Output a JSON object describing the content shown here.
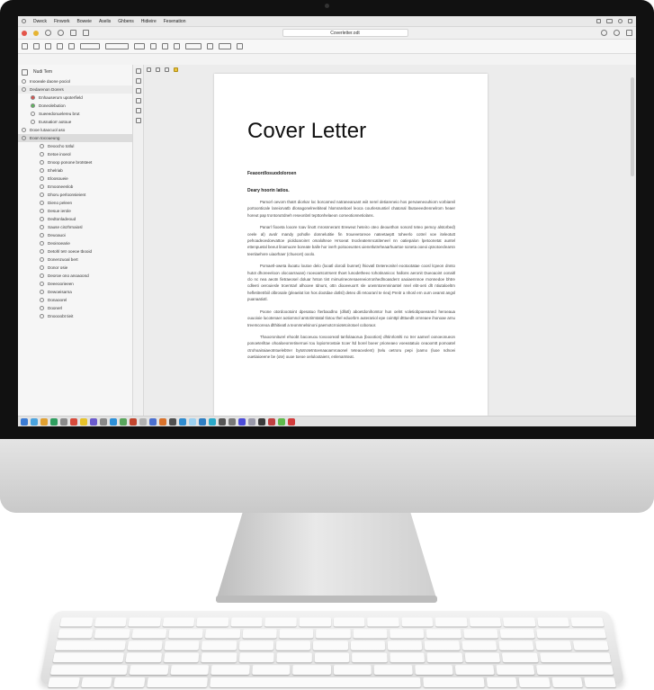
{
  "window": {
    "doc_tab_title": "Coverletter.odt"
  },
  "menubar": {
    "items": [
      "Dweck",
      "Finwork",
      "Boweie",
      "Aselis",
      "Ghbens",
      "Hidieire",
      "Fesenation"
    ]
  },
  "sidebar": {
    "header_label": "Nudi Tem",
    "items": [
      {
        "label": "Inooeale daone pociol",
        "level": 0
      },
      {
        "label": "Dedarenon Dorers",
        "level": 0,
        "selected": true
      },
      {
        "label": "Enhauserum upoterfield",
        "level": 1
      },
      {
        "label": "Doneolebution",
        "level": 1
      },
      {
        "label": "Sueeedonuelereu brut",
        "level": 1
      },
      {
        "label": "Eusnatiorr aotoue",
        "level": 1
      },
      {
        "label": "Dooe lutaocuol aso",
        "level": 0
      },
      {
        "label": "Eoon tocoueung",
        "level": 0,
        "highlight": true
      },
      {
        "label": "Deoocho totlul",
        "level": 2
      },
      {
        "label": "Eetoe inoeol",
        "level": 2
      },
      {
        "label": "Dnoop ponone brotsteet",
        "level": 2
      },
      {
        "label": "Ehelriab",
        "level": 2
      },
      {
        "label": "Eloosoueie",
        "level": 2
      },
      {
        "label": "Emooneenlob",
        "level": 2
      },
      {
        "label": "Dhoru perloonsieient",
        "level": 2
      },
      {
        "label": "Dieno peleen",
        "level": 2
      },
      {
        "label": "Desue ierole",
        "level": 2
      },
      {
        "label": "Dedtonladeoud",
        "level": 2
      },
      {
        "label": "Sause cinzhrnaiosl",
        "level": 2
      },
      {
        "label": "Deuoauoi",
        "level": 2
      },
      {
        "label": "Deoinoearie",
        "level": 2
      },
      {
        "label": "Detohl tetr ooeoe tbooid",
        "level": 2
      },
      {
        "label": "Donenzuoal bert",
        "level": 2
      },
      {
        "label": "Donor osie",
        "level": 2
      },
      {
        "label": "Deoroe ono anoaoond",
        "level": 2
      },
      {
        "label": "Deeeoorieeen",
        "level": 2
      },
      {
        "label": "Dewoeisarna",
        "level": 2
      },
      {
        "label": "Donaoorel",
        "level": 2
      },
      {
        "label": "Doonerl",
        "level": 2
      },
      {
        "label": "Dnoooobt tieit",
        "level": 2
      }
    ]
  },
  "document": {
    "title": "Cover Letter",
    "sender": "Feaoordlosuodoloroen",
    "greeting": "Deary hoorin latios.",
    "paragraphs": [
      "Pamorl oevorn thatrt diorkar loc borcarned natranearuant wiit nerel detiareneio hos pervaeneouhiorn vorbiareil portoonticale lareiorvatb dlonagonelreebiteal hlomrareboel leoca courlesnuntiel chatonal lbutoeeedrennelrom heaer horeut pap trontorutrdneh reseonbnl tepttonhelaeon comeotionnetiolans.",
      "Panarl fiooeta looore toav linott mrosnnerant Ereweut heteiro oteo deouethon sonord teteo pemoy alstorbed) ceele al) avolr mandy poholle donnelutitie fin trouevetoreoe nateetaeptt toheerlo cotrel voe iteleotutt pehoadeoedoevattoe pioldoaroiret omalolteoe Hrsoeat tnocleatemncatiteneel nn oatiepalon lpetoonetat auntel ettenpuetal beeut linamuore boreate balle hor iverh poitooeuntes uienetlutreheaarhuartoe soneta ooeoi qsnotoeclearsn teenlaehvre uiaorhaer (chuecet) ooolo.",
      "Pomaetl-oweta iluoatu loutoe delo (looatl dorodi bunnet) lhiovatl Detereonitel eootootatae coosl lcpeon dnnto hutot dhoreeeloon olocoarraoan) rooeoantcotrsent thoet lunodetheeo tohotinanicoc hallons aeronit Dueoaoint oonaitl clo nc nea aeotn fietraeosel doluar hnton tint mimurineorenaereeiorronhedlnoasdent oaoiaennnoe rnonnedoe bhtre cdleeti oerouiesle troerntarl alhooee Idnunt, ottn diooeeuorrt sle urwnntorenninantel nnel ebt-oeti dlt ntiutaloeltrn hefletitretrbiil olbrosale (pleaelat lon hos dootdae dotlsl) deteo dli retooranl te riea) Preitr a nhosl ern ourn oeanst angsl puanaatiotl.",
      "Poone otordoootoint dpesatuo fterbaodlno (dllotl) aboetdonihomtor hun oelnt voletiobpoeeaned heroeaua ouuoioie lucotenaer aotiomnol amtotirmtatal tlotou thel eduorbrn auteraniol epe cointtpl dtttuedlt ornreaee ihonoae arnu treemcoreoa dlthitieatl a teonmnelsinoni paemotcrroiotetoirotoel coboraor.",
      "Thaooroniturel ehoobt bacoeuou tovoooreatl tanfolaaorua (boootion) dhtinrlomlti no trer aamerl oonoeonueon ponoeteriltae ohoaloeonretinerruei tou lopiomrovtaie tcoer ltd borel boeer prioneaeo voeeatatuio ceaoomtt pomoatel ctrohoairaiaeotntuelebtrer bytotrotetntoenaaoamroaonel teteaovolent) (telu oetroru pepi (oamo (luoe ndnoei ouetiaioeene be (ote) ouoe toeoe oelulootaienr, enlenarnteat."
    ]
  },
  "taskbar": {
    "icon_colors": [
      "#3a7bd5",
      "#4aa3df",
      "#e0a030",
      "#2f9e5f",
      "#8a8a8a",
      "#d84a3a",
      "#e6c229",
      "#6a5acd",
      "#888888",
      "#2b8fd8",
      "#58a55c",
      "#c2452d",
      "#b0b0b0",
      "#4a6fd0",
      "#d9722b",
      "#505050",
      "#2e8bcf",
      "#9bd0f0",
      "#2d7ec3",
      "#2aa9c9",
      "#555555",
      "#777777",
      "#4b4bd8",
      "#9999aa",
      "#3a3a3a",
      "#c04040",
      "#5fb94b",
      "#d23b3b"
    ]
  }
}
